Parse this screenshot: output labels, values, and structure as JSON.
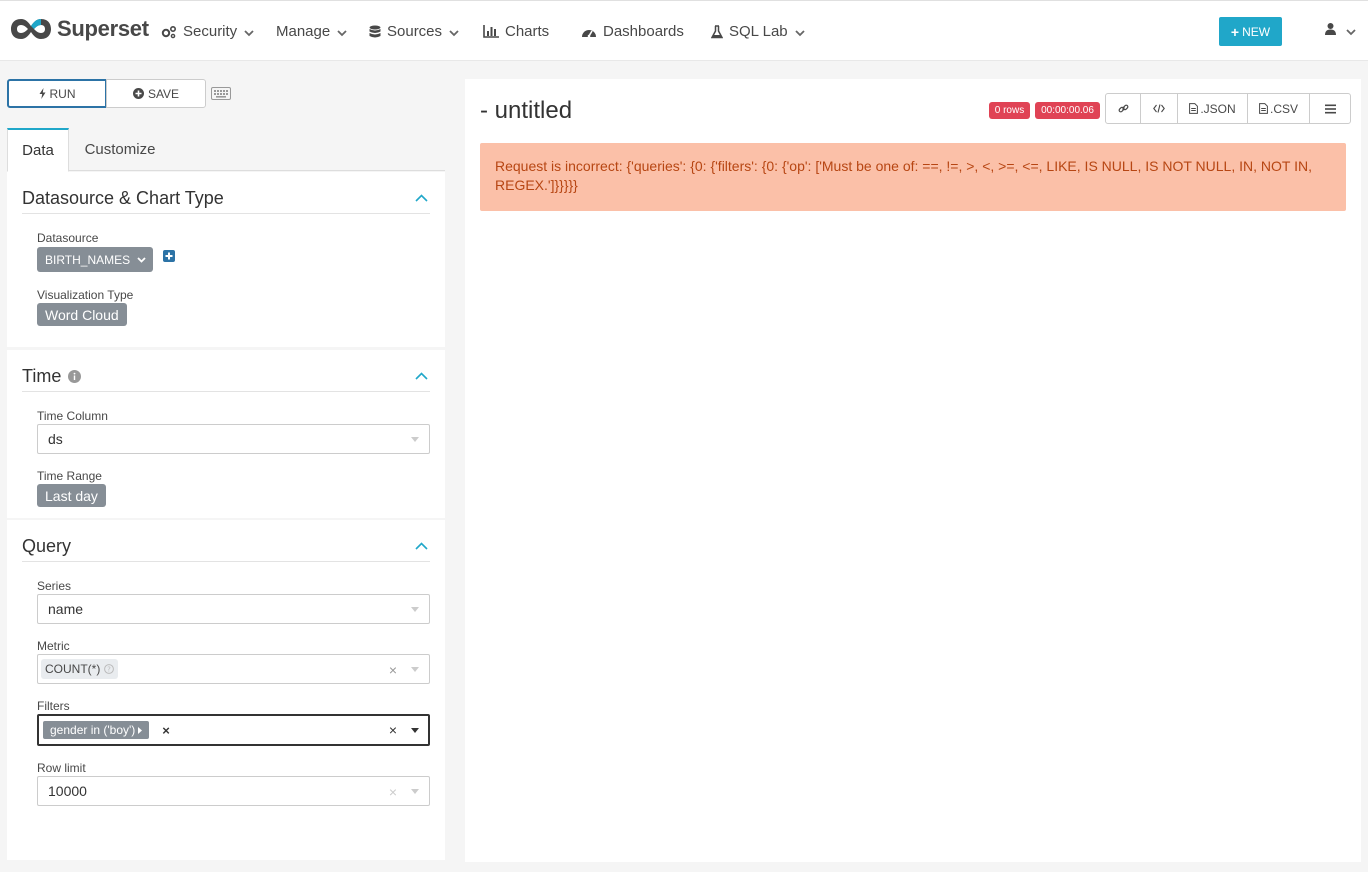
{
  "nav": {
    "brand": "Superset",
    "items": [
      {
        "label": "Security",
        "icon": "cogs-icon",
        "dropdown": true
      },
      {
        "label": "Manage",
        "icon": "",
        "dropdown": true
      },
      {
        "label": "Sources",
        "icon": "database-icon",
        "dropdown": true
      },
      {
        "label": "Charts",
        "icon": "bar-chart-icon",
        "dropdown": false
      },
      {
        "label": "Dashboards",
        "icon": "dashboard-icon",
        "dropdown": false
      },
      {
        "label": "SQL Lab",
        "icon": "flask-icon",
        "dropdown": true
      }
    ],
    "new_button": "NEW",
    "user_icon": "user-icon"
  },
  "controls": {
    "run_label": "RUN",
    "save_label": "SAVE"
  },
  "tabs": [
    {
      "label": "Data",
      "active": true
    },
    {
      "label": "Customize",
      "active": false
    }
  ],
  "sections": {
    "datasource": {
      "title": "Datasource & Chart Type",
      "datasource_label": "Datasource",
      "datasource_value": "BIRTH_NAMES",
      "viz_label": "Visualization Type",
      "viz_value": "Word Cloud"
    },
    "time": {
      "title": "Time",
      "time_column_label": "Time Column",
      "time_column_value": "ds",
      "time_range_label": "Time Range",
      "time_range_value": "Last day"
    },
    "query": {
      "title": "Query",
      "series_label": "Series",
      "series_value": "name",
      "metric_label": "Metric",
      "metric_value": "COUNT(*)",
      "filters_label": "Filters",
      "filter_value": "gender in ('boy')",
      "row_limit_label": "Row limit",
      "row_limit_value": "10000"
    }
  },
  "chart": {
    "title": "- untitled",
    "rows_badge": "0 rows",
    "time_badge": "00:00:00.06",
    "json_label": ".JSON",
    "csv_label": ".CSV",
    "error": "Request is incorrect: {'queries': {0: {'filters': {0: {'op': ['Must be one of: ==, !=, >, <, >=, <=, LIKE, IS NULL, IS NOT NULL, IN, NOT IN, REGEX.']}}}}}"
  },
  "colors": {
    "accent": "#20a7c9",
    "error_bg": "#fbc0a8",
    "error_text": "#b74613",
    "badge_red": "#e04355",
    "tag_gray": "#868e96"
  }
}
